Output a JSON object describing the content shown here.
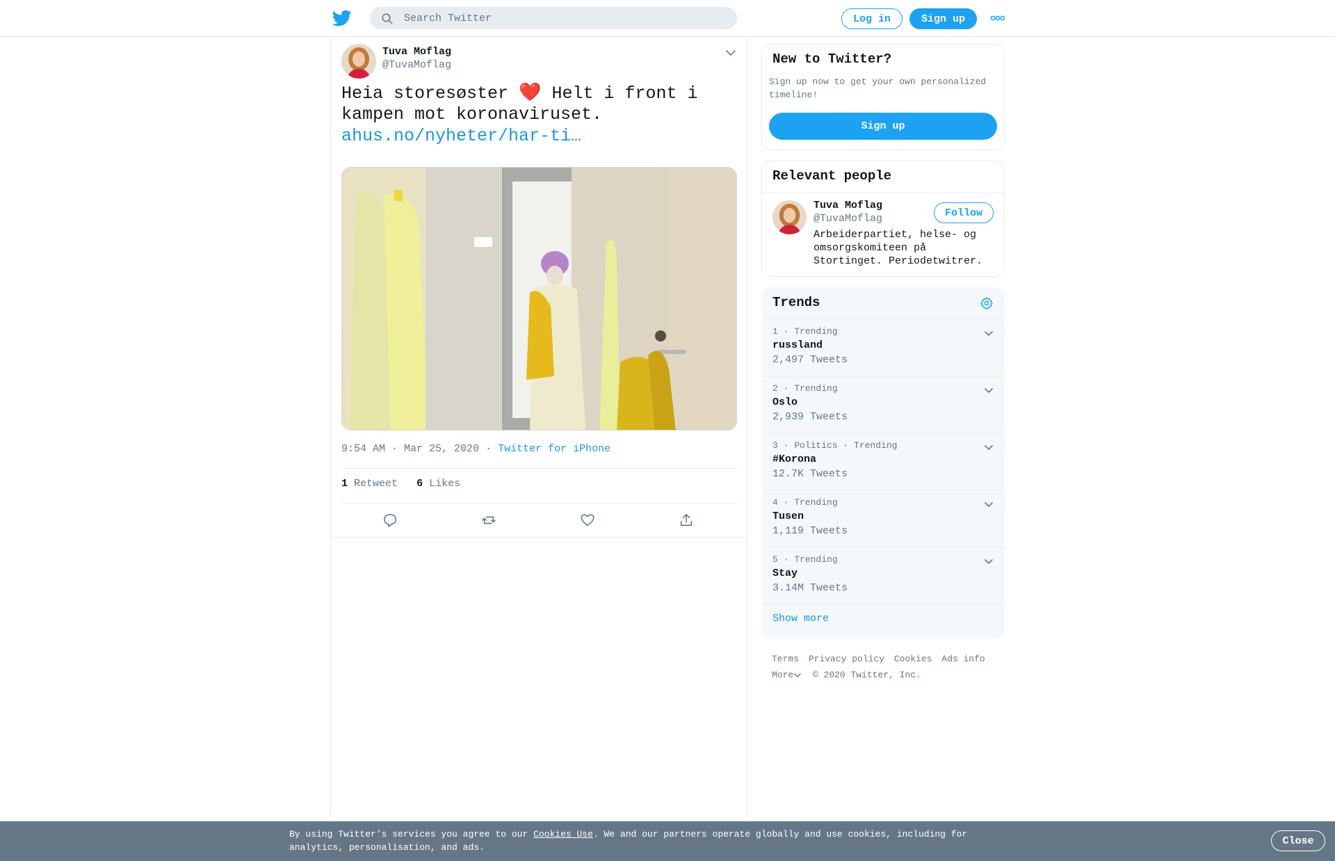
{
  "header": {
    "search_placeholder": "Search Twitter",
    "login_label": "Log in",
    "signup_label": "Sign up",
    "brand_color": "#1da1f2"
  },
  "tweet": {
    "author_name": "Tuva Moflag",
    "author_handle": "@TuvaMoflag",
    "text_part1": "Heia storesøster",
    "text_emoji": "❤️",
    "text_part2": "Helt i front i kampen mot koronaviruset.",
    "link": "ahus.no/nyheter/har-ti…",
    "timestamp": "9:54 AM · Mar 25, 2020",
    "source_sep": "·",
    "source": "Twitter for iPhone",
    "retweets_count": "1",
    "retweets_label": "Retweet",
    "likes_count": "6",
    "likes_label": "Likes"
  },
  "sidebar": {
    "new_title": "New to Twitter?",
    "new_text": "Sign up now to get your own personalized timeline!",
    "new_button": "Sign up",
    "people_title": "Relevant people",
    "person": {
      "name": "Tuva Moflag",
      "handle": "@TuvaMoflag",
      "follow_label": "Follow",
      "bio": "Arbeiderpartiet, helse- og omsorgskomiteen på Stortinget. Periodetwitrer."
    },
    "trends_title": "Trends",
    "trends": [
      {
        "meta": "1 · Trending",
        "name": "russland",
        "count": "2,497 Tweets"
      },
      {
        "meta": "2 · Trending",
        "name": "Oslo",
        "count": "2,939 Tweets"
      },
      {
        "meta": "3 · Politics · Trending",
        "name": "#Korona",
        "count": "12.7K Tweets"
      },
      {
        "meta": "4 · Trending",
        "name": "Tusen",
        "count": "1,119 Tweets"
      },
      {
        "meta": "5 · Trending",
        "name": "Stay",
        "count": "3.14M Tweets"
      }
    ],
    "show_more": "Show more",
    "footer": {
      "terms": "Terms",
      "privacy": "Privacy policy",
      "cookies": "Cookies",
      "ads": "Ads info",
      "more": "More",
      "copyright": "© 2020 Twitter, Inc."
    }
  },
  "cookie_bar": {
    "text_before": "By using Twitter’s services you agree to our ",
    "link": "Cookies Use",
    "text_after": ". We and our partners operate globally and use cookies, including for analytics, personalisation, and ads.",
    "close_label": "Close"
  }
}
